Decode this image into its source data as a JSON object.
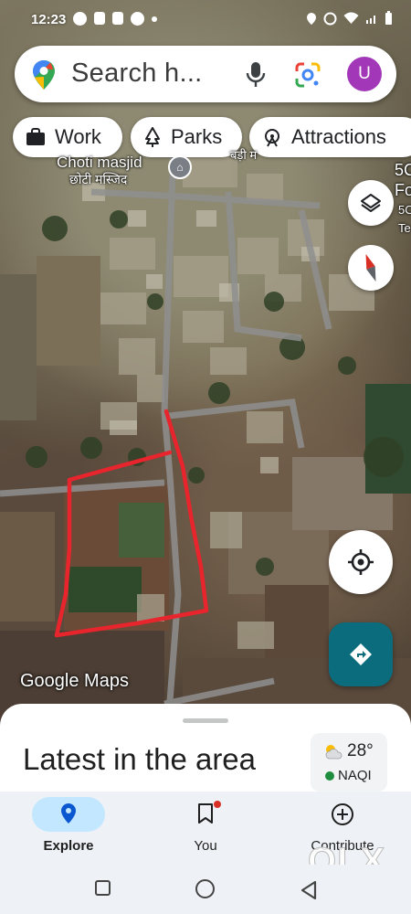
{
  "status_bar": {
    "time": "12:23"
  },
  "search": {
    "placeholder": "Search h...",
    "avatar_letter": "U"
  },
  "chips": [
    {
      "label": "Work",
      "icon": "briefcase-icon"
    },
    {
      "label": "Parks",
      "icon": "tree-icon"
    },
    {
      "label": "Attractions",
      "icon": "attraction-icon"
    }
  ],
  "map": {
    "labels": {
      "choti_masjid": "Choti masjid",
      "choti_masjid_hi": "छोटी मस्जिद",
      "badi": "बड़ी म",
      "right1": "5C",
      "right2": "Fo",
      "right3": "5C",
      "right4": "Te"
    },
    "watermark": "Google Maps"
  },
  "sheet": {
    "title": "Latest in the area",
    "weather": {
      "temperature": "28°",
      "aqi_label": "NAQI"
    }
  },
  "nav": {
    "explore": "Explore",
    "you": "You",
    "contribute": "Contribute"
  },
  "overlay": {
    "watermark": "OLX"
  },
  "colors": {
    "accent_teal": "#0b6c7d",
    "avatar": "#a238b8",
    "nav_active": "#c2e7ff",
    "annotation_red": "#e8242c"
  }
}
